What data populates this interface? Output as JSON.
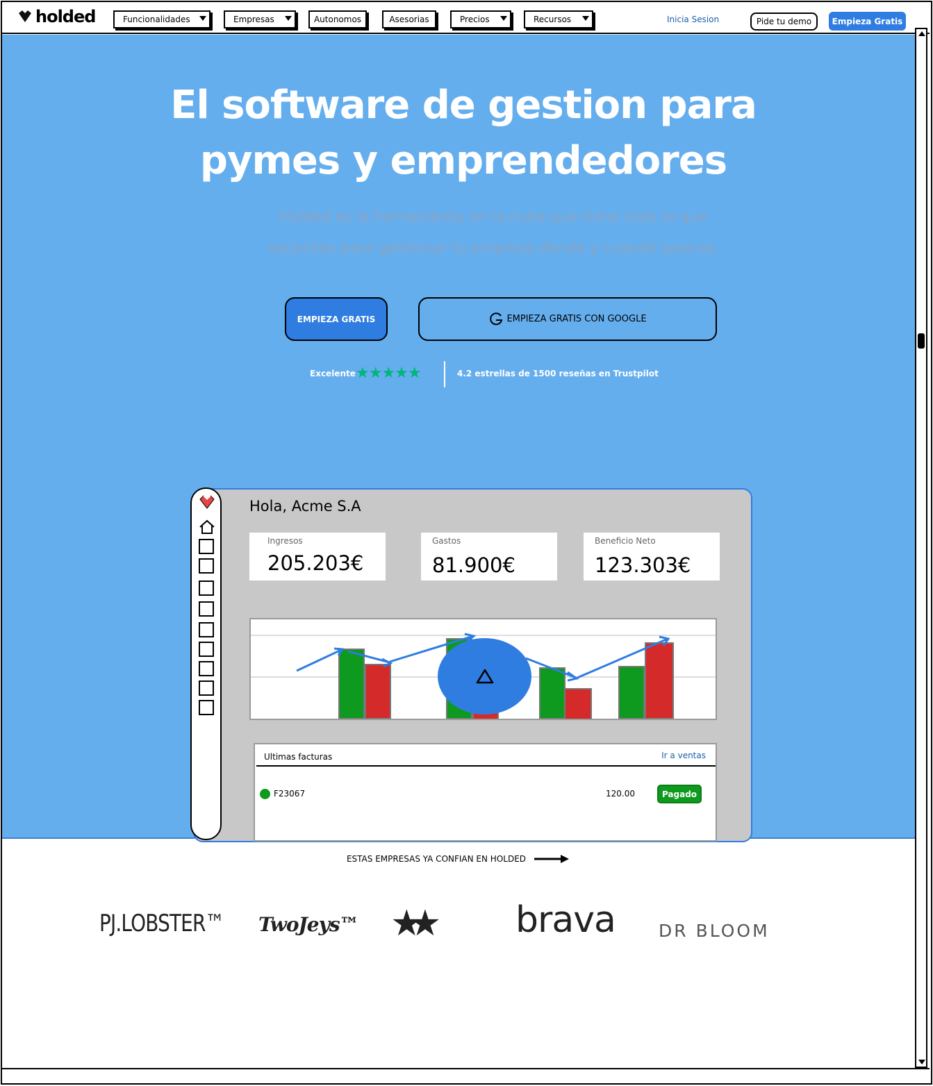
{
  "nav": {
    "logo_text": "holded",
    "menu": [
      {
        "label": "Funcionalidades",
        "dropdown": true
      },
      {
        "label": "Empresas",
        "dropdown": true
      },
      {
        "label": "Autonomos",
        "dropdown": false
      },
      {
        "label": "Asesorias",
        "dropdown": false
      },
      {
        "label": "Precios",
        "dropdown": true
      },
      {
        "label": "Recursos",
        "dropdown": true
      }
    ],
    "login": "Inicia Sesion",
    "demo": "Pide tu demo",
    "start": "Empieza Gratis"
  },
  "hero": {
    "title_line1": "El software de gestion para",
    "title_line2": "pymes y emprendedores",
    "subtitle": "Holded es la herramienta en la nube que tiene todo lo que necesitas para gestionar tu empresa donde y cuando quieras.",
    "cta_primary": "EMPIEZA GRATIS",
    "cta_google": "EMPIEZA GRATIS CON GOOGLE",
    "rating_label": "Excelente",
    "rating_stars": 5,
    "rating_text": "4.2 estrellas de 1500 reseñas en Trustpilot"
  },
  "dashboard": {
    "greeting": "Hola, Acme S.A",
    "kpis": [
      {
        "label": "Ingresos",
        "value": "205.203€"
      },
      {
        "label": "Gastos",
        "value": "81.900€"
      },
      {
        "label": "Beneficio Neto",
        "value": "123.303€"
      }
    ],
    "invoices": {
      "title": "Ultimas facturas",
      "link": "Ir a ventas",
      "rows": [
        {
          "id": "F23067",
          "amount": "120.00",
          "status": "Pagado"
        }
      ]
    }
  },
  "brands": {
    "banner": "ESTAS EMPRESAS YA CONFIAN EN HOLDED",
    "logos": [
      "PJ.LOBSTER™",
      "TwoJeys™",
      "brava",
      "DR BLOOM"
    ]
  },
  "colors": {
    "hero_bg": "#65aeee",
    "accent_blue": "#2f7de1",
    "income_green": "#0e9a1e",
    "expense_red": "#d42a2a",
    "trustpilot_green": "#00b67a"
  }
}
